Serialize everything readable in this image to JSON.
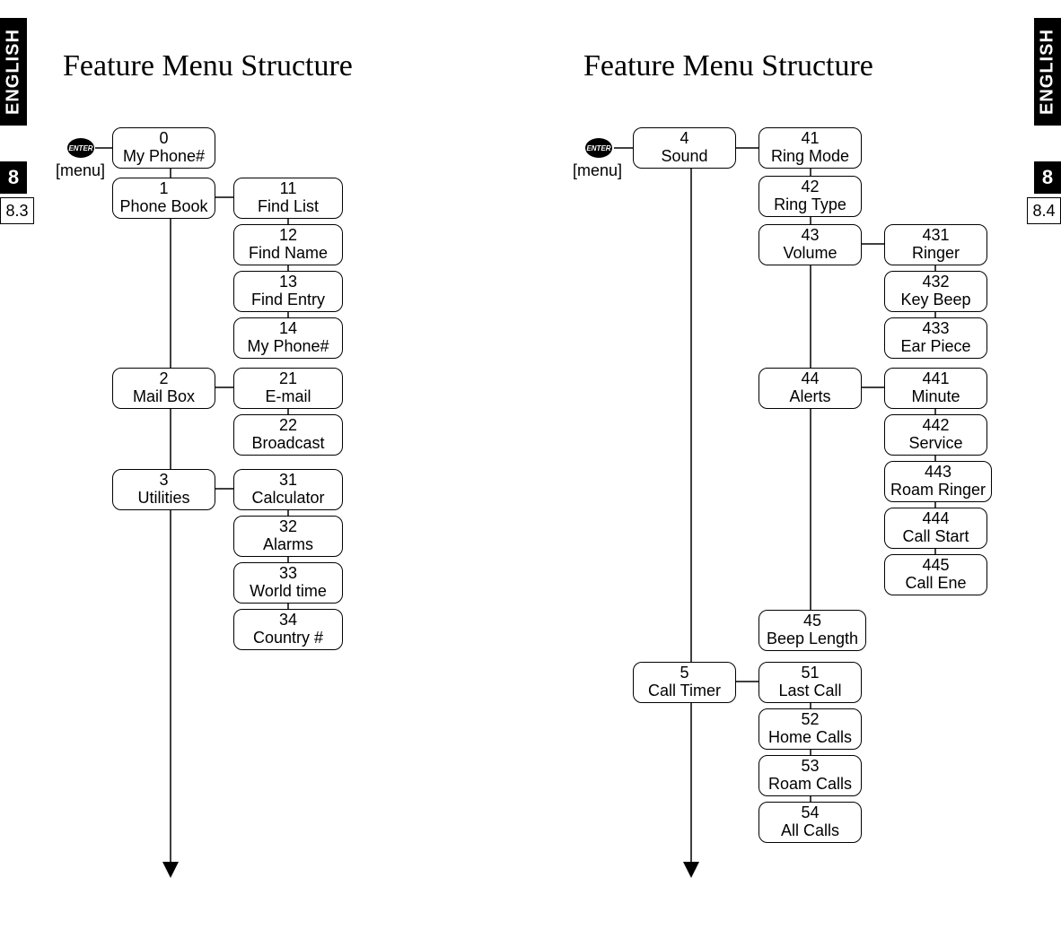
{
  "left": {
    "side_label": "ENGLISH",
    "section_number": "8",
    "page_number": "8.3",
    "title": "Feature Menu Structure",
    "menu_label": "[menu]",
    "icon_text": "ENTER",
    "nodes": {
      "n0": {
        "num": "0",
        "label": "My Phone#"
      },
      "n1": {
        "num": "1",
        "label": "Phone Book"
      },
      "n11": {
        "num": "11",
        "label": "Find List"
      },
      "n12": {
        "num": "12",
        "label": "Find Name"
      },
      "n13": {
        "num": "13",
        "label": "Find Entry"
      },
      "n14": {
        "num": "14",
        "label": "My Phone#"
      },
      "n2": {
        "num": "2",
        "label": "Mail Box"
      },
      "n21": {
        "num": "21",
        "label": "E-mail"
      },
      "n22": {
        "num": "22",
        "label": "Broadcast"
      },
      "n3": {
        "num": "3",
        "label": "Utilities"
      },
      "n31": {
        "num": "31",
        "label": "Calculator"
      },
      "n32": {
        "num": "32",
        "label": "Alarms"
      },
      "n33": {
        "num": "33",
        "label": "World time"
      },
      "n34": {
        "num": "34",
        "label": "Country #"
      }
    }
  },
  "right": {
    "side_label": "ENGLISH",
    "section_number": "8",
    "page_number": "8.4",
    "title": "Feature Menu Structure",
    "menu_label": "[menu]",
    "icon_text": "ENTER",
    "nodes": {
      "n4": {
        "num": "4",
        "label": "Sound"
      },
      "n41": {
        "num": "41",
        "label": "Ring Mode"
      },
      "n42": {
        "num": "42",
        "label": "Ring Type"
      },
      "n43": {
        "num": "43",
        "label": "Volume"
      },
      "n431": {
        "num": "431",
        "label": "Ringer"
      },
      "n432": {
        "num": "432",
        "label": "Key Beep"
      },
      "n433": {
        "num": "433",
        "label": "Ear Piece"
      },
      "n44": {
        "num": "44",
        "label": "Alerts"
      },
      "n441": {
        "num": "441",
        "label": "Minute"
      },
      "n442": {
        "num": "442",
        "label": "Service"
      },
      "n443": {
        "num": "443",
        "label": "Roam Ringer"
      },
      "n444": {
        "num": "444",
        "label": "Call Start"
      },
      "n445": {
        "num": "445",
        "label": "Call Ene"
      },
      "n45": {
        "num": "45",
        "label": "Beep Length"
      },
      "n5": {
        "num": "5",
        "label": "Call Timer"
      },
      "n51": {
        "num": "51",
        "label": "Last Call"
      },
      "n52": {
        "num": "52",
        "label": "Home Calls"
      },
      "n53": {
        "num": "53",
        "label": "Roam Calls"
      },
      "n54": {
        "num": "54",
        "label": "All Calls"
      }
    }
  }
}
